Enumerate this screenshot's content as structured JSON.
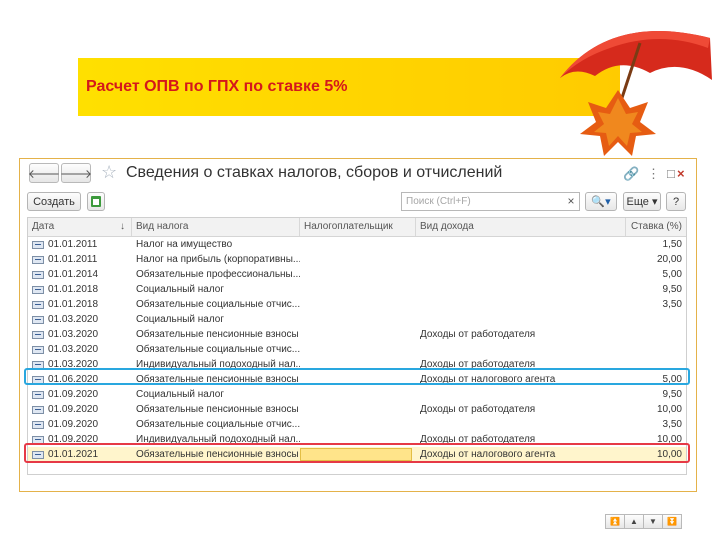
{
  "slide": {
    "title": "Расчет ОПВ по ГПХ по ставке 5%"
  },
  "window": {
    "title": "Сведения о ставках налогов, сборов и отчислений",
    "icons": [
      "arrow-left-icon",
      "arrow-right-icon",
      "star-icon",
      "link-icon",
      "more-icon",
      "close-icon"
    ]
  },
  "toolbar": {
    "create_label": "Создать",
    "search_placeholder": "Поиск (Ctrl+F)",
    "clear_label": "×",
    "more_label": "Еще ▾"
  },
  "table": {
    "headers": [
      "Дата",
      "Вид налога",
      "Налогоплательщик",
      "Вид дохода",
      "Ставка (%)"
    ],
    "rows": [
      {
        "date": "01.01.2011",
        "tax": "Налог на имущество",
        "payer": "",
        "income": "",
        "rate": "1,50"
      },
      {
        "date": "01.01.2011",
        "tax": "Налог на прибыль (корпоративны...",
        "payer": "",
        "income": "",
        "rate": "20,00"
      },
      {
        "date": "01.01.2014",
        "tax": "Обязательные профессиональны...",
        "payer": "",
        "income": "",
        "rate": "5,00"
      },
      {
        "date": "01.01.2018",
        "tax": "Социальный налог",
        "payer": "",
        "income": "",
        "rate": "9,50"
      },
      {
        "date": "01.01.2018",
        "tax": "Обязательные социальные отчис...",
        "payer": "",
        "income": "",
        "rate": "3,50"
      },
      {
        "date": "01.03.2020",
        "tax": "Социальный налог",
        "payer": "",
        "income": "",
        "rate": ""
      },
      {
        "date": "01.03.2020",
        "tax": "Обязательные пенсионные взносы",
        "payer": "",
        "income": "Доходы от работодателя",
        "rate": ""
      },
      {
        "date": "01.03.2020",
        "tax": "Обязательные социальные отчис...",
        "payer": "",
        "income": "",
        "rate": ""
      },
      {
        "date": "01.03.2020",
        "tax": "Индивидуальный подоходный нал...",
        "payer": "",
        "income": "Доходы от работодателя",
        "rate": ""
      },
      {
        "date": "01.06.2020",
        "tax": "Обязательные пенсионные взносы",
        "payer": "",
        "income": "Доходы от налогового агента",
        "rate": "5,00"
      },
      {
        "date": "01.09.2020",
        "tax": "Социальный налог",
        "payer": "",
        "income": "",
        "rate": "9,50"
      },
      {
        "date": "01.09.2020",
        "tax": "Обязательные пенсионные взносы",
        "payer": "",
        "income": "Доходы от работодателя",
        "rate": "10,00"
      },
      {
        "date": "01.09.2020",
        "tax": "Обязательные социальные отчис...",
        "payer": "",
        "income": "",
        "rate": "3,50"
      },
      {
        "date": "01.09.2020",
        "tax": "Индивидуальный подоходный нал...",
        "payer": "",
        "income": "Доходы от работодателя",
        "rate": "10,00"
      },
      {
        "date": "01.01.2021",
        "tax": "Обязательные пенсионные взносы",
        "payer": "",
        "income": "Доходы от налогового агента",
        "rate": "10,00"
      }
    ],
    "nav_buttons": [
      "first-page-icon",
      "prev-page-icon",
      "next-page-icon",
      "last-page-icon"
    ]
  },
  "colors": {
    "title_text": "#d4181b",
    "title_bar": "#ffd400",
    "highlight_blue": "#29a7df",
    "highlight_red": "#e63946",
    "selected_cell": "#ffe48a"
  }
}
